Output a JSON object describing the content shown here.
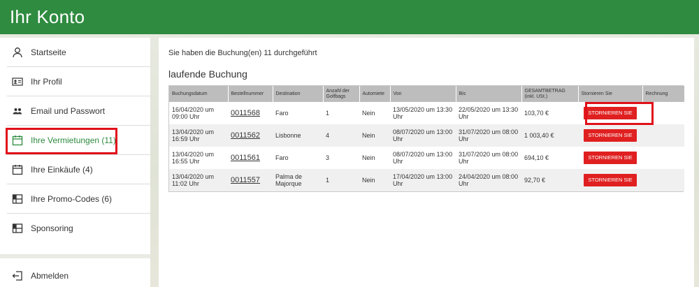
{
  "header": {
    "title": "Ihr Konto"
  },
  "sidebar": {
    "items": [
      {
        "label": "Startseite",
        "icon": "user-icon"
      },
      {
        "label": "Ihr Profil",
        "icon": "id-card-icon"
      },
      {
        "label": "Email und Passwort",
        "icon": "users-icon"
      },
      {
        "label": "Ihre Vermietungen (11)",
        "icon": "calendar-icon",
        "active": true
      },
      {
        "label": "Ihre Einkäufe (4)",
        "icon": "calendar-icon"
      },
      {
        "label": "Ihre Promo-Codes (6)",
        "icon": "grid-icon"
      },
      {
        "label": "Sponsoring",
        "icon": "grid-icon"
      }
    ],
    "logout": {
      "label": "Abmelden",
      "icon": "logout-icon"
    }
  },
  "main": {
    "info": "Sie haben die Buchung(en) 11 durchgeführt",
    "section_title": "laufende Buchung",
    "columns": [
      "Buchungsdatum",
      "Bestellnummer",
      "Destination",
      "Anzahl der Golfbags",
      "Automiete",
      "Von",
      "Bis",
      "GESAMTBETRAG (inkl. USt.)",
      "Stornieren Sie",
      "Rechnung"
    ],
    "rows": [
      {
        "date": "16/04/2020 um 09:00 Uhr",
        "order": "0011568",
        "destination": "Faro",
        "bags": "1",
        "car": "Nein",
        "from": "13/05/2020 um 13:30 Uhr",
        "to": "22/05/2020 um 13:30 Uhr",
        "total": "103,70 €",
        "cancel": "STORNIEREN SIE",
        "invoice": ""
      },
      {
        "date": "13/04/2020 um 16:59 Uhr",
        "order": "0011562",
        "destination": "Lisbonne",
        "bags": "4",
        "car": "Nein",
        "from": "08/07/2020 um 13:00 Uhr",
        "to": "31/07/2020 um 08:00 Uhr",
        "total": "1 003,40 €",
        "cancel": "STORNIEREN SIE",
        "invoice": ""
      },
      {
        "date": "13/04/2020 um 16:55 Uhr",
        "order": "0011561",
        "destination": "Faro",
        "bags": "3",
        "car": "Nein",
        "from": "08/07/2020 um 13:00 Uhr",
        "to": "31/07/2020 um 08:00 Uhr",
        "total": "694,10 €",
        "cancel": "STORNIEREN SIE",
        "invoice": ""
      },
      {
        "date": "13/04/2020 um 11:02 Uhr",
        "order": "0011557",
        "destination": "Palma de Majorque",
        "bags": "1",
        "car": "Nein",
        "from": "17/04/2020 um 13:00 Uhr",
        "to": "24/04/2020 um 08:00 Uhr",
        "total": "92,70 €",
        "cancel": "STORNIEREN SIE",
        "invoice": ""
      }
    ]
  },
  "colors": {
    "brand_green": "#2e8b3f",
    "cancel_red": "#e02020",
    "highlight_red": "#e0101a",
    "header_gray": "#bdbdbd"
  }
}
